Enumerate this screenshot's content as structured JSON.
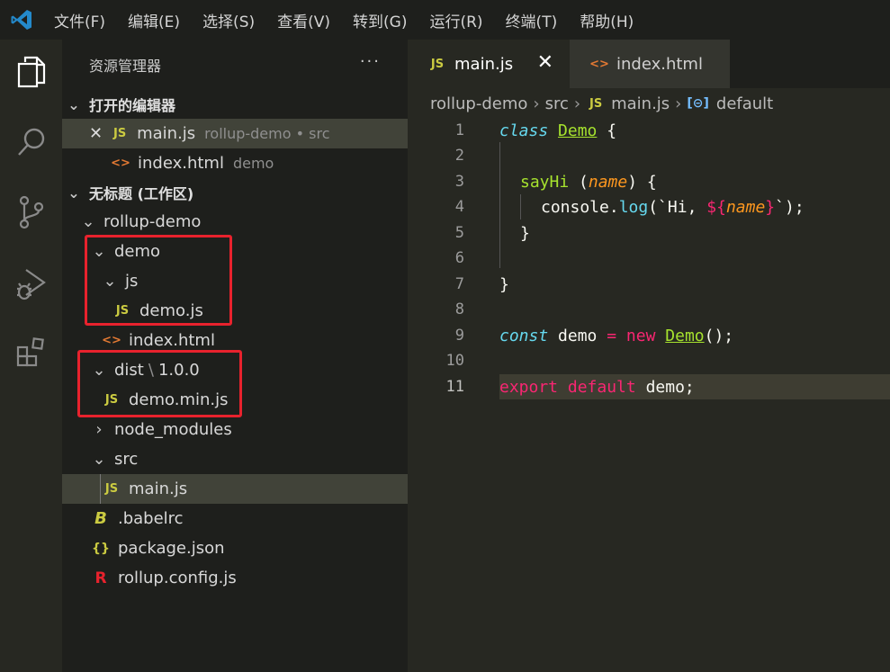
{
  "menubar": [
    "文件(F)",
    "编辑(E)",
    "选择(S)",
    "查看(V)",
    "转到(G)",
    "运行(R)",
    "终端(T)",
    "帮助(H)"
  ],
  "sidebar": {
    "title": "资源管理器",
    "more": "···",
    "open_editors": {
      "label": "打开的编辑器",
      "items": [
        {
          "icon": "JS",
          "name": "main.js",
          "desc": "rollup-demo • src",
          "close": "✕"
        },
        {
          "icon": "<>",
          "name": "index.html",
          "desc": "demo"
        }
      ]
    },
    "workspace": {
      "label": "无标题 (工作区)",
      "tree": [
        {
          "name": "rollup-demo"
        },
        {
          "name": "demo"
        },
        {
          "name": "js"
        },
        {
          "name": "demo.js",
          "icon": "JS"
        },
        {
          "name": "index.html",
          "icon": "<>"
        },
        {
          "name": "dist",
          "sep": "\\",
          "suffix": "1.0.0"
        },
        {
          "name": "demo.min.js",
          "icon": "JS"
        },
        {
          "name": "node_modules"
        },
        {
          "name": "src"
        },
        {
          "name": "main.js",
          "icon": "JS"
        },
        {
          "name": ".babelrc",
          "icon": "B"
        },
        {
          "name": "package.json",
          "icon": "{}"
        },
        {
          "name": "rollup.config.js",
          "icon": "R"
        }
      ]
    }
  },
  "tabs": [
    {
      "icon": "JS",
      "label": "main.js",
      "close": "✕"
    },
    {
      "icon": "<>",
      "label": "index.html"
    }
  ],
  "breadcrumb": [
    "rollup-demo",
    "src",
    "main.js",
    "default"
  ],
  "code": {
    "line_numbers": [
      "1",
      "2",
      "3",
      "4",
      "5",
      "6",
      "7",
      "8",
      "9",
      "10",
      "11"
    ],
    "tokens": {
      "l1": [
        "class",
        "Demo",
        "{"
      ],
      "l3": [
        "sayHi",
        "(",
        "name",
        ") {"
      ],
      "l4": [
        "console.",
        "log",
        "(`Hi, ",
        "${",
        "name",
        "}",
        "`);"
      ],
      "l5": [
        "}"
      ],
      "l7": [
        "}"
      ],
      "l9": [
        "const",
        " demo ",
        "=",
        " ",
        "new",
        " ",
        "Demo",
        "();"
      ],
      "l11": [
        "export",
        " ",
        "default",
        " demo;"
      ]
    }
  },
  "colors": {
    "accent_red_box": "#e8222d",
    "js_icon": "#cbcb41",
    "html_icon": "#e37933",
    "vscode_blue": "#2489ca"
  }
}
